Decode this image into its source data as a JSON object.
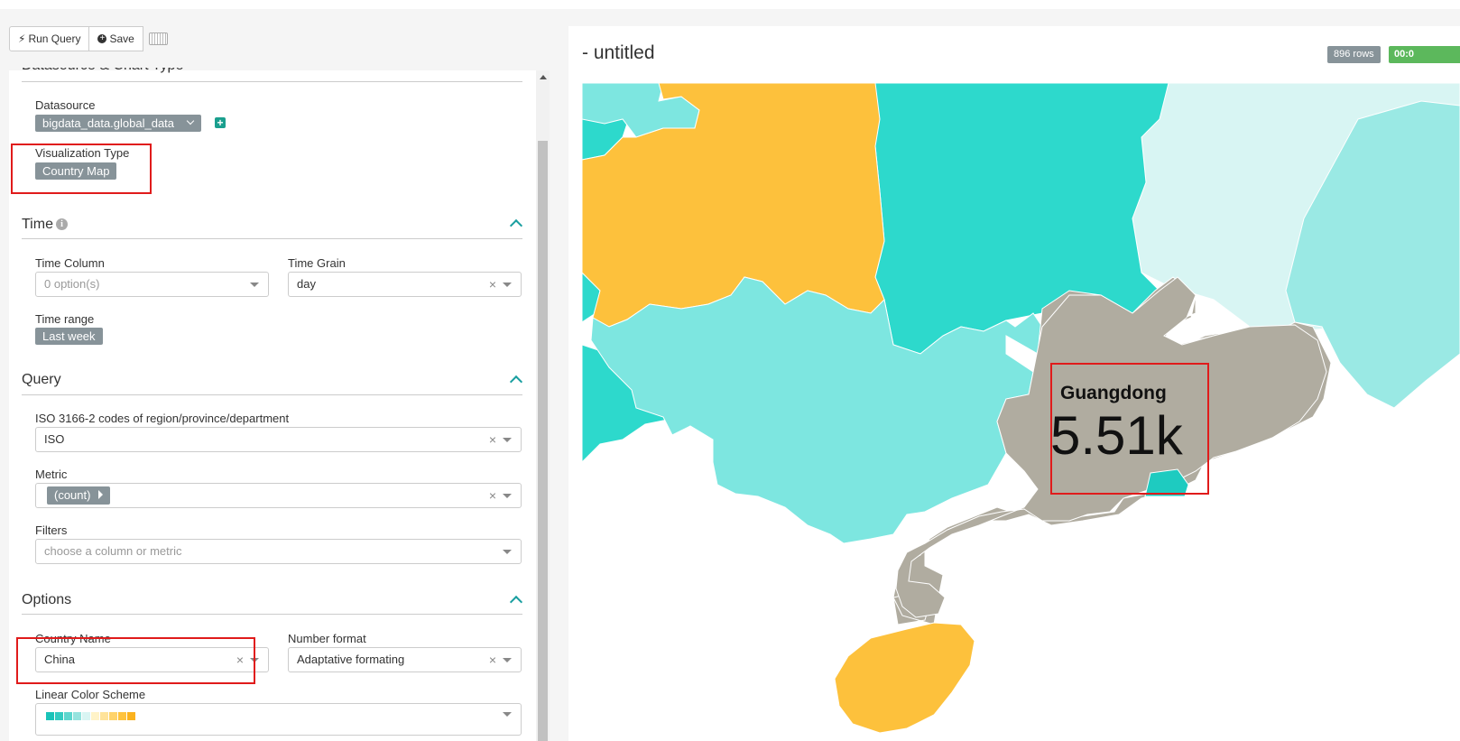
{
  "toolbar": {
    "run_query": "Run Query",
    "save": "Save"
  },
  "panel": {
    "section_datasource": "Datasource & Chart Type",
    "datasource_label": "Datasource",
    "datasource_value": "bigdata_data.global_data",
    "viztype_label": "Visualization Type",
    "viztype_value": "Country Map",
    "section_time": "Time",
    "time_column_label": "Time Column",
    "time_column_placeholder": "0 option(s)",
    "time_grain_label": "Time Grain",
    "time_grain_value": "day",
    "time_range_label": "Time range",
    "time_range_value": "Last week",
    "section_query": "Query",
    "iso_label": "ISO 3166-2 codes of region/province/department",
    "iso_value": "ISO",
    "metric_label": "Metric",
    "metric_value": "(count)",
    "filters_label": "Filters",
    "filters_placeholder": "choose a column or metric",
    "section_options": "Options",
    "country_label": "Country Name",
    "country_value": "China",
    "number_format_label": "Number format",
    "number_format_value": "Adaptative formating",
    "color_scheme_label": "Linear Color Scheme",
    "clear_symbol": "×"
  },
  "chart": {
    "title": "- untitled",
    "rows_badge": "896 rows",
    "time_badge": "00:0",
    "highlight_name": "Guangdong",
    "highlight_value": "5.51k"
  },
  "colors": {
    "accent": "#1a9fa0",
    "gold": "#fdc13c",
    "teal": "#2dd9cc",
    "light_teal": "#7de6e0",
    "pale_teal": "#d8f5f3",
    "mid_teal": "#9ae9e4",
    "highlight_gray": "#b0aca0",
    "status_green": "#5cb85c"
  },
  "color_scheme_swatches": [
    "#1ac3b8",
    "#32cbc1",
    "#5dd6ce",
    "#95e3de",
    "#d9f5f3",
    "#fff3c8",
    "#ffe39a",
    "#ffd36b",
    "#ffc33e",
    "#fbb21e"
  ]
}
